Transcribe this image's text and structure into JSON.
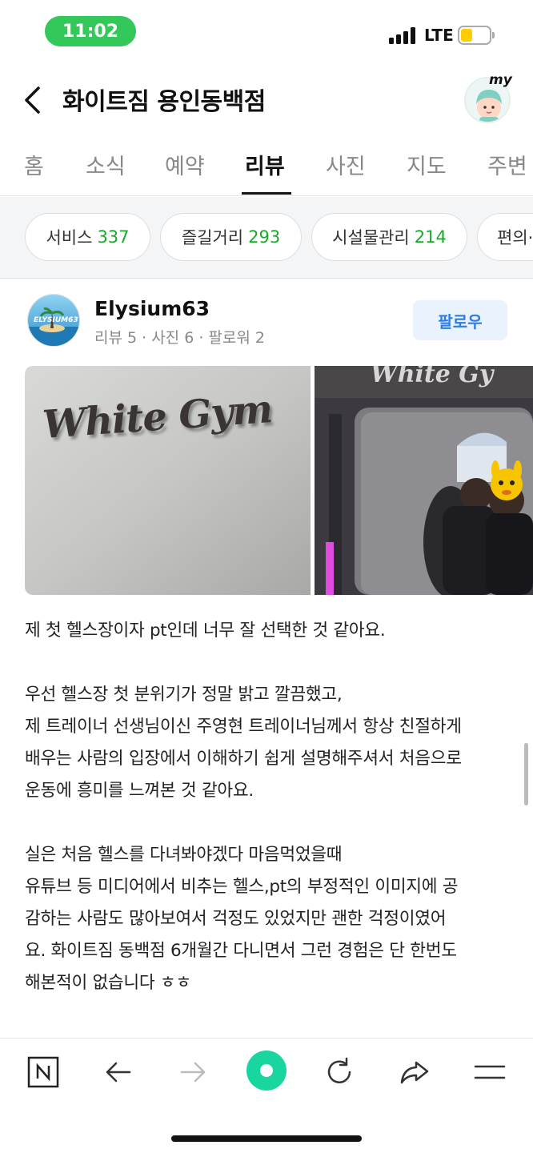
{
  "status": {
    "time": "11:02",
    "network": "LTE",
    "battery_color": "#ffcc00"
  },
  "header": {
    "title": "화이트짐 용인동백점",
    "my_label": "my"
  },
  "tabs": [
    {
      "label": "홈"
    },
    {
      "label": "소식"
    },
    {
      "label": "예약"
    },
    {
      "label": "리뷰",
      "active": true
    },
    {
      "label": "사진"
    },
    {
      "label": "지도"
    },
    {
      "label": "주변"
    }
  ],
  "chips": [
    {
      "label": "서비스",
      "count": "337"
    },
    {
      "label": "즐길거리",
      "count": "293"
    },
    {
      "label": "시설물관리",
      "count": "214"
    },
    {
      "label": "편의·"
    }
  ],
  "review": {
    "reviewer_name": "Elysium63",
    "avatar_text": "ELYSIUM63",
    "stats": "리뷰 5 · 사진 6 · 팔로워 2",
    "follow_label": "팔로우",
    "photo_sign": "White Gym",
    "paragraphs": [
      [
        "제 첫 헬스장이자 pt인데 너무 잘 선택한 것 같아요."
      ],
      [
        "우선 헬스장 첫 분위기가 정말 밝고 깔끔했고,",
        "제 트레이너 선생님이신 주영현 트레이너님께서 항상 친절하게",
        "배우는 사람의 입장에서 이해하기 쉽게 설명해주셔서 처음으로",
        "운동에 흥미를 느껴본 것 같아요."
      ],
      [
        "실은 처음 헬스를 다녀봐야겠다 마음먹었을때",
        "유튜브 등 미디어에서 비추는 헬스,pt의 부정적인 이미지에 공",
        "감하는 사람도 많아보여서 걱정도 있었지만 괜한 걱정이였어",
        "요. 화이트짐 동백점 6개월간 다니면서 그런 경험은 단 한번도",
        "해본적이 없습니다 ㅎㅎ"
      ]
    ]
  },
  "colors": {
    "accent_green": "#19a92c",
    "time_pill": "#34c759",
    "follow_blue": "#2f7de1",
    "home_button": "#19d6a0"
  },
  "bottom_nav": [
    "naver-n-icon",
    "back-arrow-icon",
    "forward-arrow-icon",
    "home-dot-icon",
    "refresh-icon",
    "share-icon",
    "menu-icon"
  ]
}
